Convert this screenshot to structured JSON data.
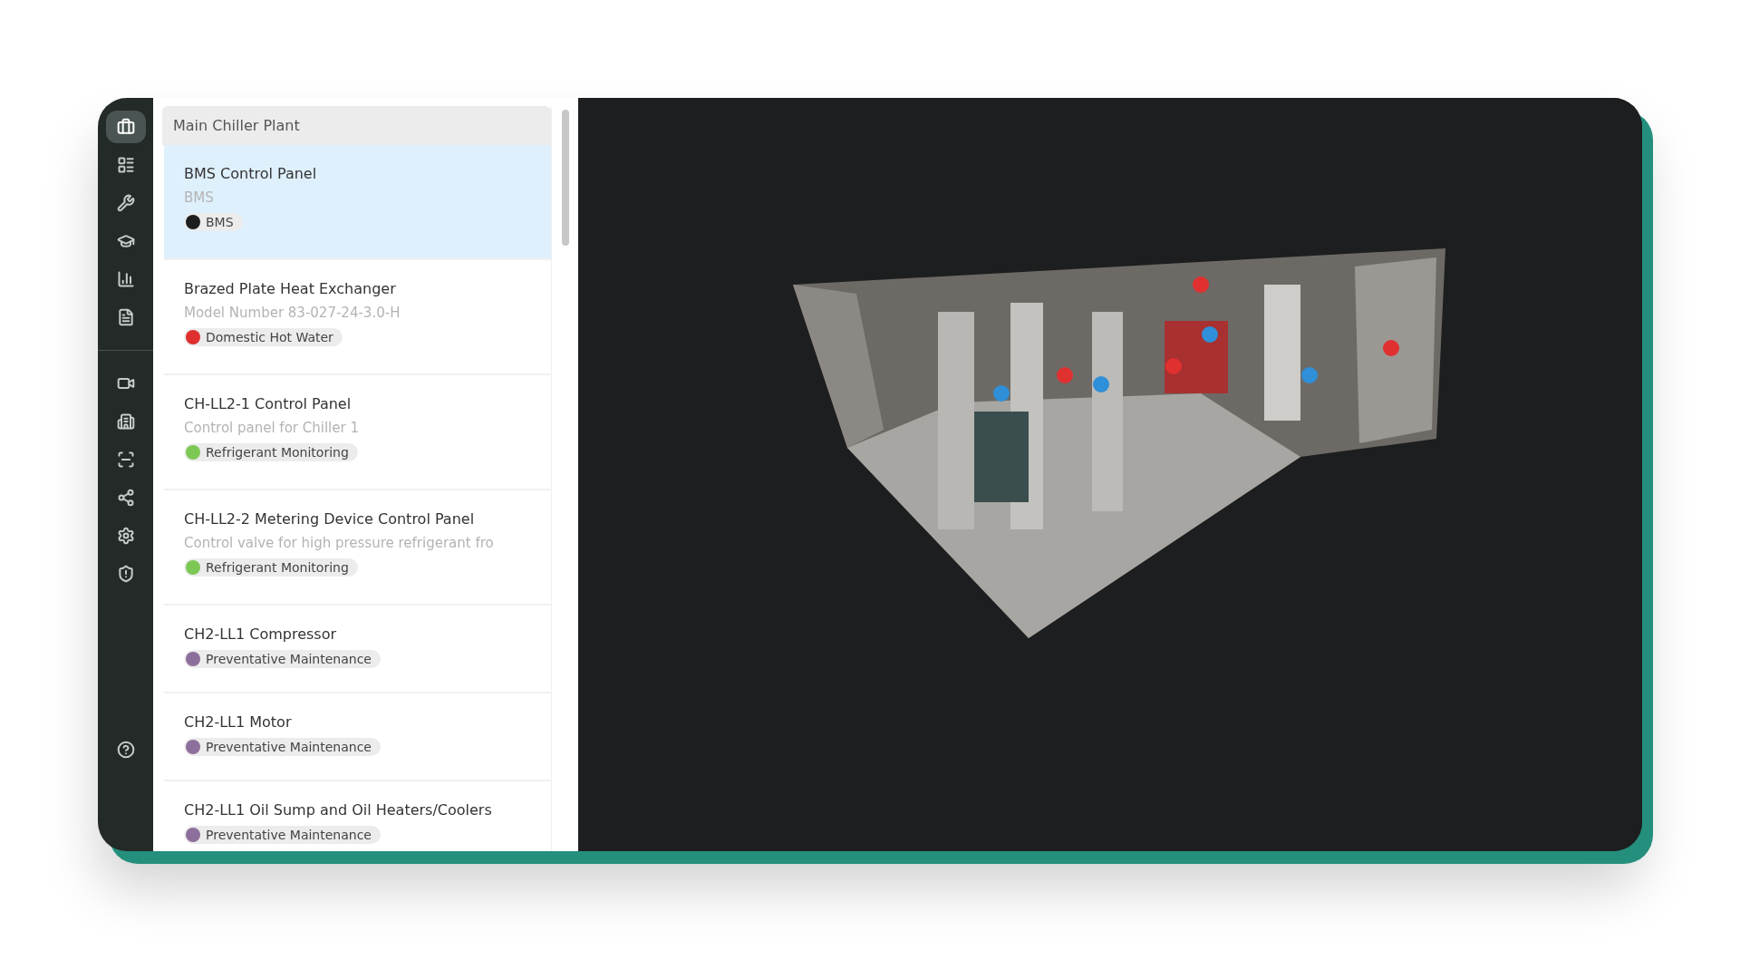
{
  "sidebar": {
    "items": [
      {
        "selected": true
      },
      {
        "selected": false
      },
      {
        "selected": false
      },
      {
        "selected": false
      },
      {
        "selected": false
      },
      {
        "selected": false
      },
      {
        "selected": false
      },
      {
        "selected": false
      },
      {
        "selected": false
      },
      {
        "selected": false
      },
      {
        "selected": false
      },
      {
        "selected": false
      }
    ]
  },
  "list": {
    "title": "Main Chiller Plant",
    "items": [
      {
        "title": "BMS Control Panel",
        "subtitle": "BMS",
        "tag": {
          "label": "BMS",
          "color": "#1e1e1e"
        },
        "selected": true
      },
      {
        "title": "Brazed Plate Heat Exchanger",
        "subtitle": "Model Number 83-027-24-3.0-H",
        "tag": {
          "label": "Domestic Hot Water",
          "color": "#e02f2f"
        },
        "selected": false
      },
      {
        "title": "CH-LL2-1 Control Panel",
        "subtitle": "Control panel for Chiller 1",
        "tag": {
          "label": "Refrigerant Monitoring",
          "color": "#7dc855"
        },
        "selected": false
      },
      {
        "title": "CH-LL2-2 Metering Device Control Panel",
        "subtitle": "Control valve for high pressure refrigerant fro",
        "tag": {
          "label": "Refrigerant Monitoring",
          "color": "#7dc855"
        },
        "selected": false
      },
      {
        "title": "CH2-LL1 Compressor",
        "tag": {
          "label": "Preventative Maintenance",
          "color": "#8d6f9c"
        },
        "selected": false
      },
      {
        "title": "CH2-LL1 Motor",
        "tag": {
          "label": "Preventative Maintenance",
          "color": "#8d6f9c"
        },
        "selected": false
      },
      {
        "title": "CH2-LL1 Oil Sump and Oil Heaters/Coolers",
        "tag": {
          "label": "Preventative Maintenance",
          "color": "#8d6f9c"
        },
        "selected": false
      }
    ]
  }
}
